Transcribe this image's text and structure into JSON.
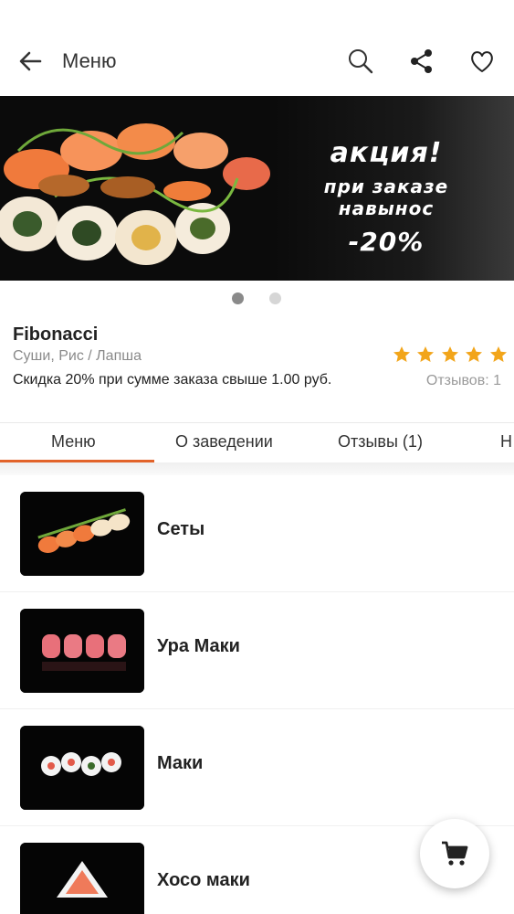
{
  "header": {
    "title": "Меню",
    "icons": [
      "back-arrow-icon",
      "search-icon",
      "share-icon",
      "heart-icon"
    ]
  },
  "banner": {
    "line1": "акция!",
    "line2": "при заказе",
    "line3": "навынос",
    "line4": "-20%"
  },
  "carousel": {
    "current_page": 1,
    "total_pages": 2
  },
  "restaurant": {
    "name": "Fibonacci",
    "cuisine": "Суши, Рис / Лапша",
    "discount": "Скидка 20% при сумме заказа свыше 1.00 руб.",
    "rating": 5,
    "reviews": "Отзывов: 1"
  },
  "tabs": [
    {
      "label": "Меню"
    },
    {
      "label": "О заведении"
    },
    {
      "label": "Отзывы (1)"
    },
    {
      "label": "Н"
    }
  ],
  "categories": [
    {
      "label": "Сеты"
    },
    {
      "label": "Ура Маки"
    },
    {
      "label": "Маки"
    },
    {
      "label": "Хосо маки"
    }
  ],
  "colors": {
    "accent": "#e2632a",
    "star": "#f2a51a"
  },
  "fab": {
    "icon": "cart-icon"
  }
}
